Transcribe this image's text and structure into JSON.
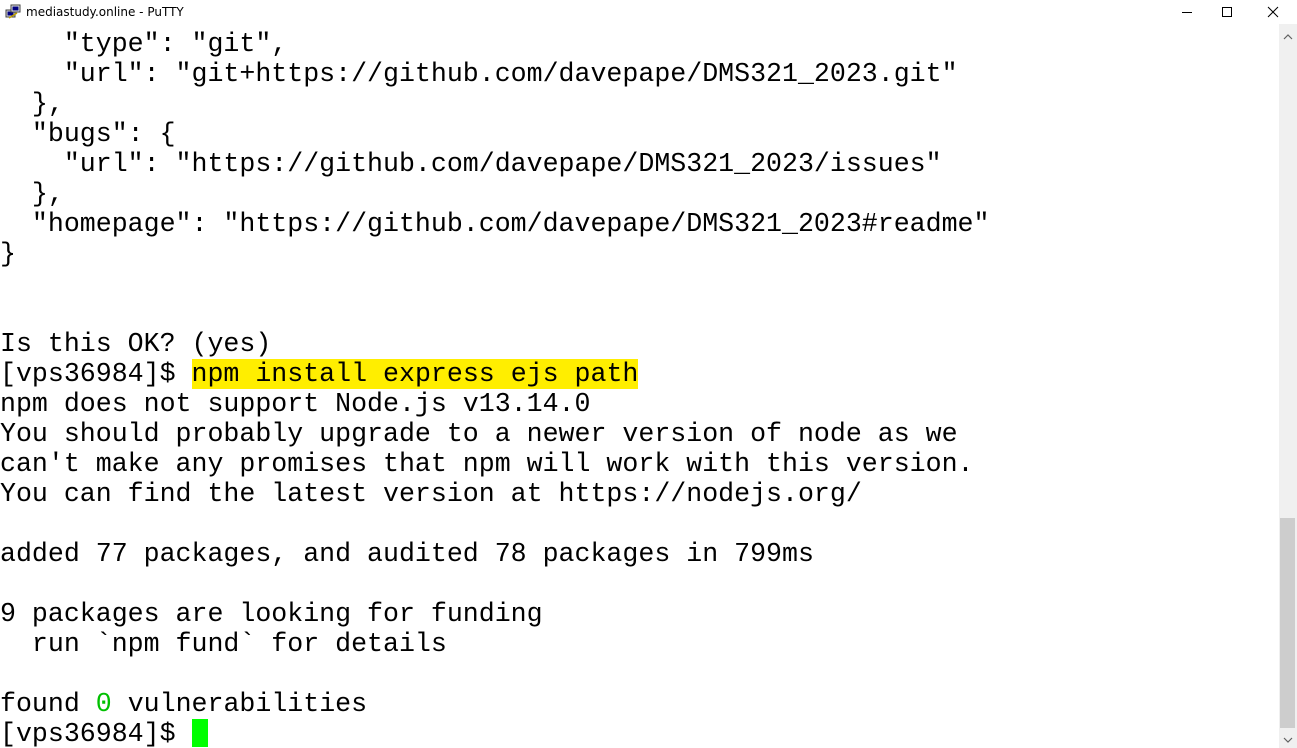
{
  "window": {
    "title": "mediastudy.online - PuTTY",
    "app_icon": "putty-icon",
    "controls": {
      "minimize": "minimize-icon",
      "maximize": "maximize-icon",
      "close": "close-icon"
    }
  },
  "terminal": {
    "lines": [
      "    \"type\": \"git\",",
      "    \"url\": \"git+https://github.com/davepape/DMS321_2023.git\"",
      "  },",
      "  \"bugs\": {",
      "    \"url\": \"https://github.com/davepape/DMS321_2023/issues\"",
      "  },",
      "  \"homepage\": \"https://github.com/davepape/DMS321_2023#readme\"",
      "}",
      "",
      "",
      "Is this OK? (yes)",
      "",
      "npm does not support Node.js v13.14.0",
      "You should probably upgrade to a newer version of node as we",
      "can't make any promises that npm will work with this version.",
      "You can find the latest version at https://nodejs.org/",
      "",
      "added 77 packages, and audited 78 packages in 799ms",
      "",
      "9 packages are looking for funding",
      "  run `npm fund` for details",
      "",
      "",
      ""
    ],
    "prompt": "[vps36984]$ ",
    "highlighted_command": "npm install express ejs path",
    "found_prefix": "found ",
    "found_count": "0",
    "found_suffix": " vulnerabilities",
    "colors": {
      "background": "#ffffff",
      "foreground": "#000000",
      "highlight": "#ffee00",
      "count_green": "#00c000",
      "cursor": "#00ff00"
    }
  }
}
